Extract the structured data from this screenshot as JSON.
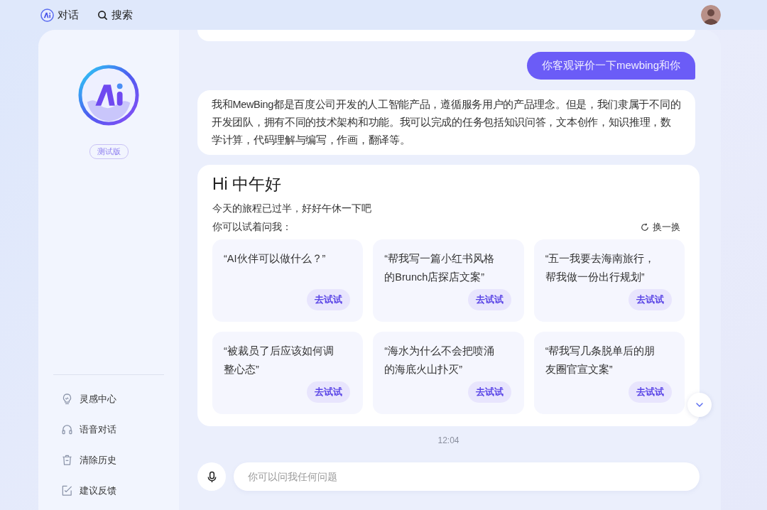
{
  "nav": {
    "chat_label": "对话",
    "search_label": "搜索"
  },
  "sidebar": {
    "badge": "测试版",
    "items": [
      {
        "kind": "bulb",
        "label": "灵感中心"
      },
      {
        "kind": "headphones",
        "label": "语音对话"
      },
      {
        "kind": "trash",
        "label": "清除历史"
      },
      {
        "kind": "feedback",
        "label": "建议反馈"
      }
    ]
  },
  "messages": [
    {
      "kind": "outgoing",
      "text": "你客观评价一下mewbing和你"
    },
    {
      "kind": "incoming",
      "text": "我和MewBing都是百度公司开发的人工智能产品，遵循服务用户的产品理念。但是，我们隶属于不同的开发团队，拥有不同的技术架构和功能。我可以完成的任务包括知识问答，文本创作，知识推理，数学计算，代码理解与编写，作画，翻译等。"
    }
  ],
  "welcome": {
    "title": "Hi 中午好",
    "subtitle": "今天的旅程已过半，好好午休一下吧",
    "prompt": "你可以试着问我：",
    "refresh": "换一换",
    "suggestions": [
      {
        "text": "“AI伙伴可以做什么？”",
        "button": "去试试"
      },
      {
        "text": "“帮我写一篇小红书风格的Brunch店探店文案”",
        "button": "去试试"
      },
      {
        "text": "“五一我要去海南旅行，帮我做一份出行规划”",
        "button": "去试试"
      },
      {
        "text": "“被裁员了后应该如何调整心态”",
        "button": "去试试"
      },
      {
        "text": "“海水为什么不会把喷涌的海底火山扑灭”",
        "button": "去试试"
      },
      {
        "text": "“帮我写几条脱单后的朋友圈官宣文案”",
        "button": "去试试"
      }
    ]
  },
  "time": "12:04",
  "input": {
    "placeholder": "你可以问我任何问题"
  }
}
